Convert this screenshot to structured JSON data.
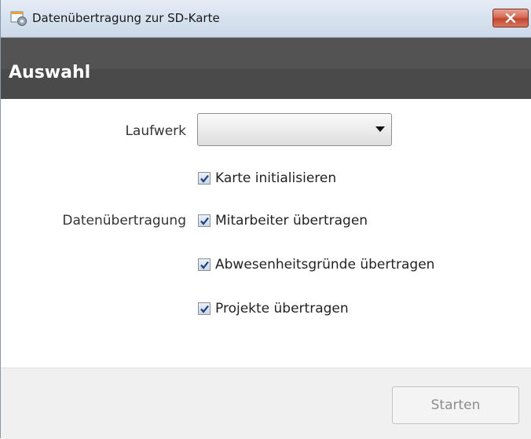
{
  "window": {
    "title": "Datenübertragung zur SD-Karte"
  },
  "header": {
    "title": "Auswahl"
  },
  "form": {
    "drive_label": "Laufwerk",
    "drive_value": "",
    "transfer_label": "Datenübertragung",
    "options": [
      {
        "label": "Karte initialisieren",
        "checked": true
      },
      {
        "label": "Mitarbeiter übertragen",
        "checked": true
      },
      {
        "label": "Abwesenheitsgründe übertragen",
        "checked": true
      },
      {
        "label": "Projekte übertragen",
        "checked": true
      }
    ]
  },
  "footer": {
    "start_label": "Starten"
  },
  "colors": {
    "header_bg": "#4a4a4a",
    "close_button": "#c44630",
    "checkbox_check": "#1f3f73"
  },
  "icons": {
    "app": "window-settings-icon",
    "close": "close-icon",
    "dropdown": "chevron-down-icon",
    "check": "checkmark-icon"
  }
}
